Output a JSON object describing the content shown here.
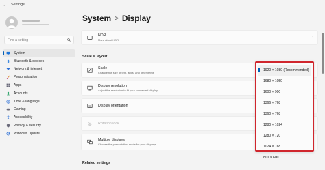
{
  "window": {
    "title": "Settings"
  },
  "sidebar": {
    "search_placeholder": "Find a setting",
    "items": [
      {
        "label": "System",
        "icon": "monitor-icon",
        "active": true
      },
      {
        "label": "Bluetooth & devices",
        "icon": "bluetooth-icon"
      },
      {
        "label": "Network & internet",
        "icon": "wifi-icon"
      },
      {
        "label": "Personalisation",
        "icon": "brush-icon"
      },
      {
        "label": "Apps",
        "icon": "apps-icon"
      },
      {
        "label": "Accounts",
        "icon": "person-icon"
      },
      {
        "label": "Time & language",
        "icon": "globe-icon"
      },
      {
        "label": "Gaming",
        "icon": "gamepad-icon"
      },
      {
        "label": "Accessibility",
        "icon": "accessibility-icon"
      },
      {
        "label": "Privacy & security",
        "icon": "shield-icon"
      },
      {
        "label": "Windows Update",
        "icon": "update-icon"
      }
    ]
  },
  "header": {
    "crumb1": "System",
    "separator": ">",
    "crumb2": "Display"
  },
  "cards": {
    "hdr": {
      "title": "HDR",
      "desc": "More about HDR"
    },
    "scale": {
      "title": "Scale",
      "desc": "Change the size of text, apps, and other items"
    },
    "resolution": {
      "title": "Display resolution",
      "desc": "Adjust the resolution to fit your connected display"
    },
    "orientation": {
      "title": "Display orientation"
    },
    "rotation": {
      "title": "Rotation lock"
    },
    "multiple": {
      "title": "Multiple displays",
      "desc": "Choose the presentation mode for your displays"
    }
  },
  "sections": {
    "scale_layout": "Scale & layout",
    "related": "Related settings"
  },
  "resolution_dropdown": {
    "options": [
      "1920 × 1080 (Recommended)",
      "1680 × 1050",
      "1600 × 900",
      "1366 × 768",
      "1360 × 768",
      "1280 × 1024",
      "1280 × 720",
      "1024 × 768",
      "800 × 600"
    ],
    "selected_index": 0,
    "highlight_color": "#d0262d"
  },
  "colors": {
    "accent": "#005fb8",
    "background": "#f3f3f3",
    "card": "#fbfbfb"
  }
}
